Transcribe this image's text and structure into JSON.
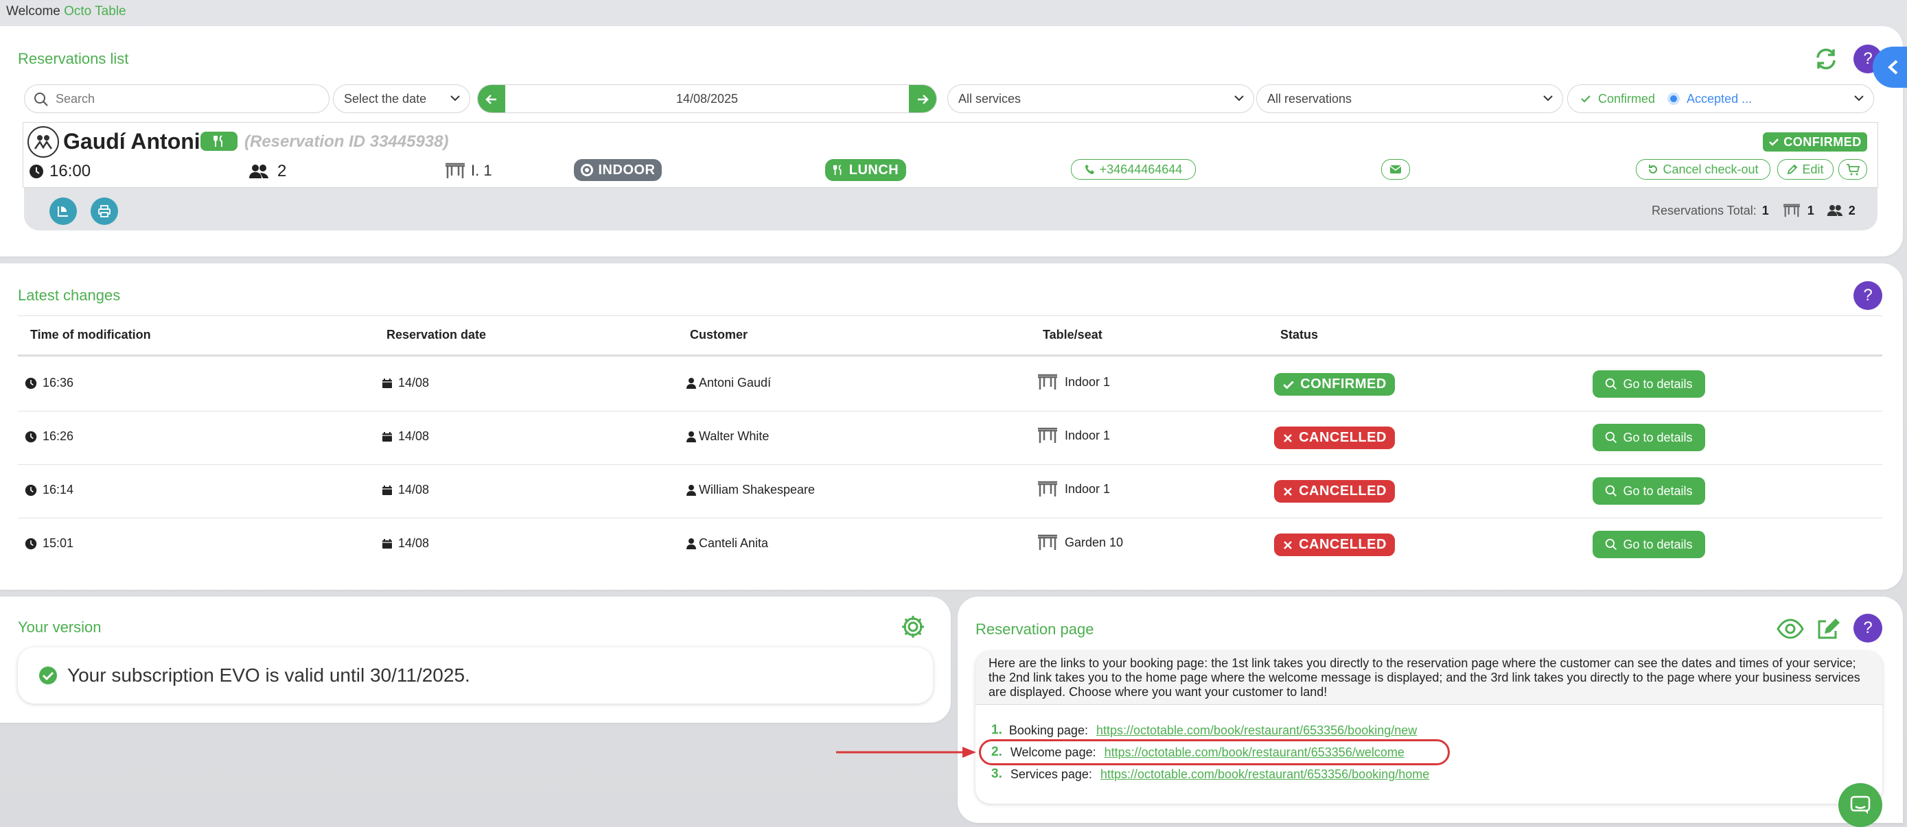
{
  "welcome": {
    "prefix": "Welcome",
    "user": "Octo Table"
  },
  "reservations": {
    "title": "Reservations list",
    "search_placeholder": "Search",
    "date_select": "Select the date",
    "date": "14/08/2025",
    "services": "All services",
    "res_filter": "All reservations",
    "status_filter": {
      "confirmed": "Confirmed",
      "accepted": "Accepted ..."
    },
    "item": {
      "name": "Gaudí Antoni",
      "res_id": "(Reservation ID 33445938)",
      "time": "16:00",
      "people": "2",
      "table": "I. 1",
      "area": "INDOOR",
      "service": "LUNCH",
      "phone": "+34644464644",
      "status": "CONFIRMED",
      "cancel_checkout": "Cancel check-out",
      "edit": "Edit"
    },
    "totals": {
      "label": "Reservations Total:",
      "count": "1",
      "tables": "1",
      "people": "2"
    }
  },
  "latest": {
    "title": "Latest changes",
    "headers": [
      "Time of modification",
      "Reservation date",
      "Customer",
      "Table/seat",
      "Status"
    ],
    "rows": [
      {
        "time": "16:36",
        "date": "14/08",
        "customer": "Antoni Gaudí",
        "table": "Indoor 1",
        "status": "CONFIRMED",
        "action": "Go to details"
      },
      {
        "time": "16:26",
        "date": "14/08",
        "customer": "Walter White",
        "table": "Indoor 1",
        "status": "CANCELLED",
        "action": "Go to details"
      },
      {
        "time": "16:14",
        "date": "14/08",
        "customer": "William Shakespeare",
        "table": "Indoor 1",
        "status": "CANCELLED",
        "action": "Go to details"
      },
      {
        "time": "15:01",
        "date": "14/08",
        "customer": "Canteli Anita",
        "table": "Garden 10",
        "status": "CANCELLED",
        "action": "Go to details"
      }
    ]
  },
  "version": {
    "title": "Your version",
    "message": "Your subscription EVO is valid until 30/11/2025."
  },
  "respage": {
    "title": "Reservation page",
    "description": "Here are the links to your booking page: the 1st link takes you directly to the reservation page where the customer can see the dates and times of your service; the 2nd link takes you to the home page where the welcome message is displayed; and the 3rd link takes you directly to the page where your business services are displayed. Choose where you want your customer to land!",
    "links": [
      {
        "num": "1.",
        "label": "Booking page:",
        "url": "https://octotable.com/book/restaurant/653356/booking/new"
      },
      {
        "num": "2.",
        "label": "Welcome page:",
        "url": "https://octotable.com/book/restaurant/653356/welcome"
      },
      {
        "num": "3.",
        "label": "Services page:",
        "url": "https://octotable.com/book/restaurant/653356/booking/home"
      }
    ]
  },
  "colors": {
    "green": "#4caf50",
    "red": "#d9383a",
    "purple": "#6a3fc2",
    "blue": "#3d8bf2",
    "grey_badge": "#6c757d",
    "teal": "#3aa0b8"
  }
}
